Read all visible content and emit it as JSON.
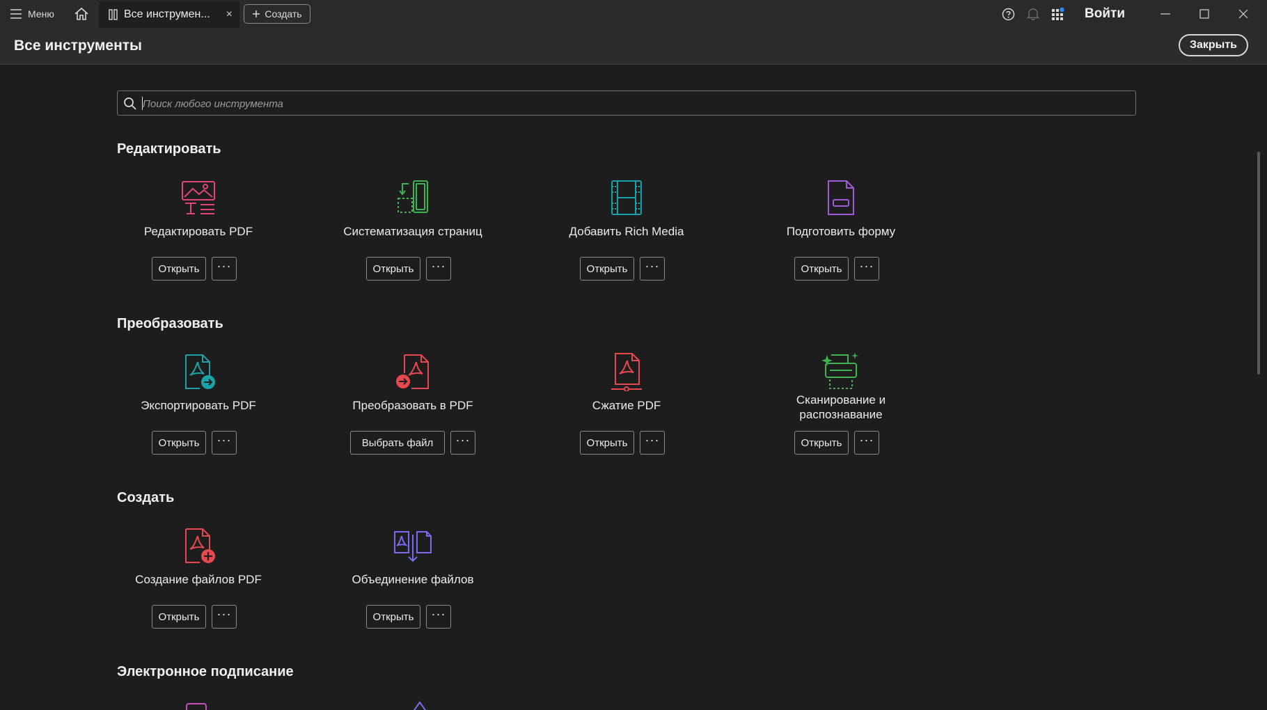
{
  "titlebar": {
    "menu_label": "Меню",
    "tab_label": "Все инструмен...",
    "tab_close": "×",
    "create_label": "Создать",
    "login_label": "Войти",
    "icons": [
      "menu-icon",
      "home-icon",
      "tools-icon",
      "help-icon",
      "bell-icon",
      "apps-icon",
      "minimize-icon",
      "maximize-icon",
      "close-icon"
    ]
  },
  "header": {
    "title": "Все инструменты",
    "close_label": "Закрыть"
  },
  "search": {
    "placeholder": "Поиск любого инструмента"
  },
  "sections": [
    {
      "title": "Редактировать",
      "tools": [
        {
          "name": "Редактировать PDF",
          "button": "Открыть",
          "more": "···",
          "icon": "edit-pdf-icon",
          "color": "#e0457b"
        },
        {
          "name": "Систематизация страниц",
          "button": "Открыть",
          "more": "···",
          "icon": "organize-pages-icon",
          "color": "#3fb34f"
        },
        {
          "name": "Добавить Rich Media",
          "button": "Открыть",
          "more": "···",
          "icon": "rich-media-icon",
          "color": "#1aa3a8"
        },
        {
          "name": "Подготовить форму",
          "button": "Открыть",
          "more": "···",
          "icon": "prepare-form-icon",
          "color": "#a05bd6"
        }
      ]
    },
    {
      "title": "Преобразовать",
      "tools": [
        {
          "name": "Экспортировать PDF",
          "button": "Открыть",
          "more": "···",
          "icon": "export-pdf-icon",
          "color": "#1aa3a8"
        },
        {
          "name": "Преобразовать в PDF",
          "button": "Выбрать файл",
          "more": "···",
          "icon": "create-pdf-icon",
          "color": "#e5484d"
        },
        {
          "name": "Сжатие PDF",
          "button": "Открыть",
          "more": "···",
          "icon": "compress-pdf-icon",
          "color": "#e5484d"
        },
        {
          "name": "Сканирование и",
          "name2": "распознавание",
          "button": "Открыть",
          "more": "···",
          "icon": "scan-ocr-icon",
          "color": "#3fb34f"
        }
      ]
    },
    {
      "title": "Создать",
      "tools": [
        {
          "name": "Создание файлов PDF",
          "button": "Открыть",
          "more": "···",
          "icon": "new-pdf-icon",
          "color": "#e5484d"
        },
        {
          "name": "Объединение файлов",
          "button": "Открыть",
          "more": "···",
          "icon": "combine-files-icon",
          "color": "#7a6cf0"
        }
      ]
    },
    {
      "title": "Электронное подписание",
      "tools": []
    }
  ]
}
